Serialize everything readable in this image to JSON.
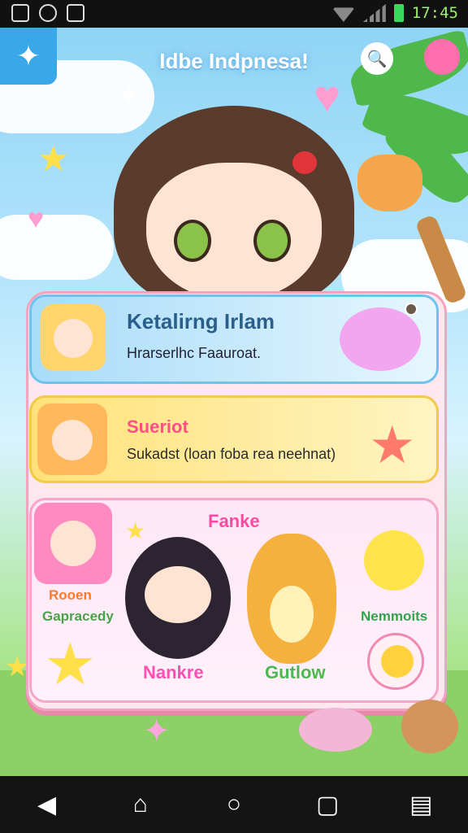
{
  "status_bar": {
    "time": "17:45",
    "icons": [
      "image-icon",
      "world-icon",
      "gallery-icon"
    ]
  },
  "app": {
    "title": "Idbe Indpnesa!",
    "menu_icon": "sparkle-icon",
    "search_icon": "search-icon"
  },
  "cards": [
    {
      "title": "Ketalirng Irlam",
      "subtitle": "Hrarserlhc Faauroat."
    },
    {
      "title": "Sueriot",
      "subtitle": "Sukadst (loan foba rea neehnat)"
    },
    {
      "header": "Fanke",
      "left_title": "Rooen",
      "left_subtitle": "Gapracedy",
      "right_label": "Nemmoits",
      "name_left": "Nankre",
      "name_right": "Gutlow"
    }
  ],
  "nav": {
    "buttons": [
      "back-icon",
      "home-outline-icon",
      "circle-home-icon",
      "recent-apps-icon",
      "menu-icon"
    ]
  }
}
